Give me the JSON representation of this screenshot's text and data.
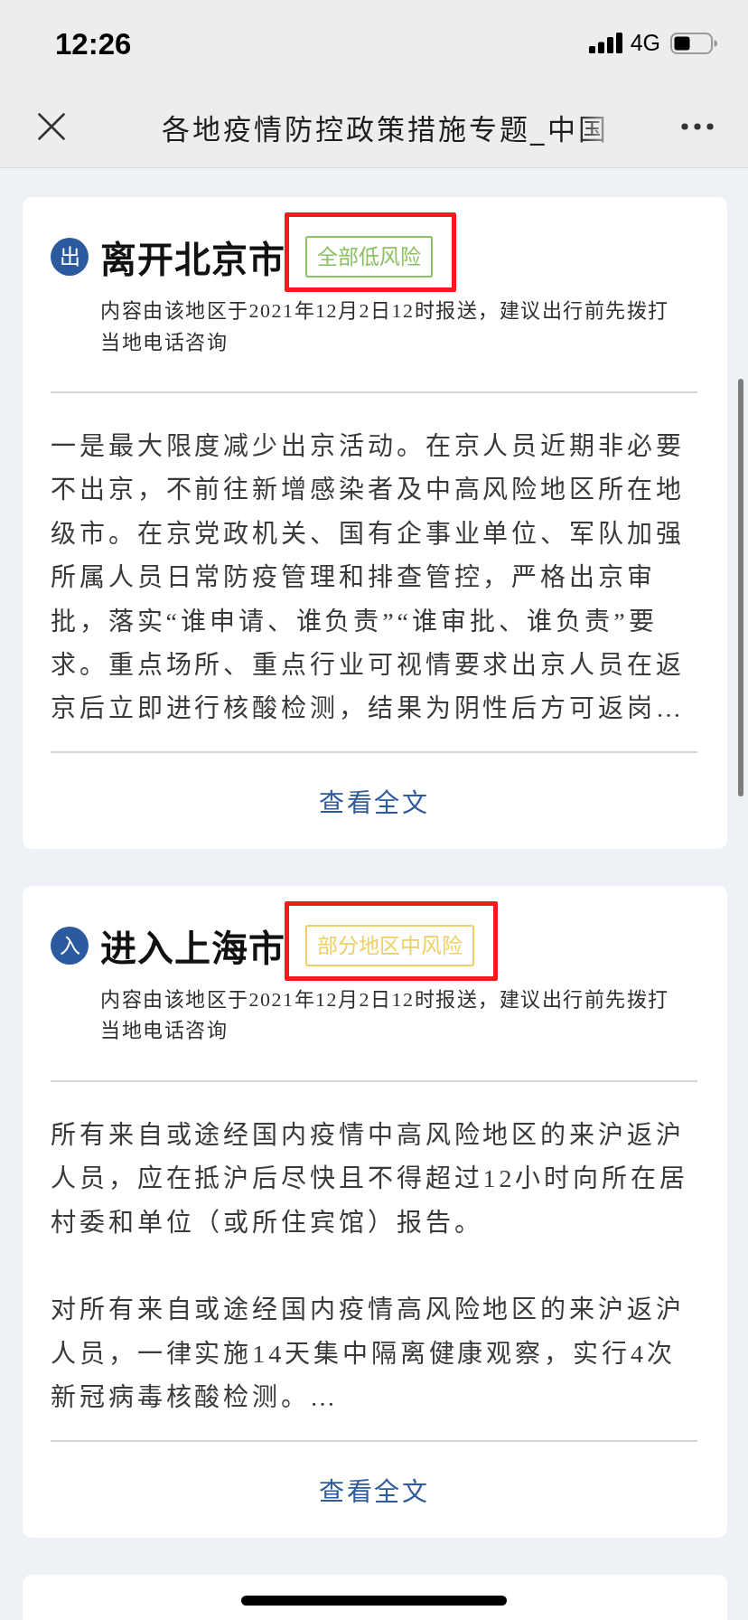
{
  "status_bar": {
    "time": "12:26",
    "network": "4G"
  },
  "nav_bar": {
    "title": "各地疫情防控政策措施专题_中国"
  },
  "cards": [
    {
      "direction": "出",
      "title": "离开北京市",
      "risk_tag": {
        "label": "全部低风险",
        "color": "#8cc063",
        "highlighted": true
      },
      "note": "内容由该地区于2021年12月2日12时报送，建议出行前先拨打当地电话咨询",
      "paragraphs": [
        "一是最大限度减少出京活动。在京人员近期非必要不出京，不前往新增感染者及中高风险地区所在地级市。在京党政机关、国有企事业单位、军队加强所属人员日常防疫管理和排查管控，严格出京审批，落实“谁申请、谁负责”“谁审批、谁负责”要求。重点场所、重点行业可视情要求出京人员在返京后立即进行核酸检测，结果为阴性后方可返岗…"
      ],
      "link": "查看全文"
    },
    {
      "direction": "入",
      "title": "进入上海市",
      "risk_tag": {
        "label": "部分地区中风险",
        "color": "#eed066",
        "highlighted": true
      },
      "note": "内容由该地区于2021年12月2日12时报送，建议出行前先拨打当地电话咨询",
      "paragraphs": [
        "所有来自或途经国内疫情中高风险地区的来沪返沪人员，应在抵沪后尽快且不得超过12小时向所在居村委和单位（或所住宾馆）报告。",
        "对所有来自或途经国内疫情高风险地区的来沪返沪人员，一律实施14天集中隔离健康观察，实行4次新冠病毒核酸检测。…"
      ],
      "link": "查看全文"
    }
  ]
}
